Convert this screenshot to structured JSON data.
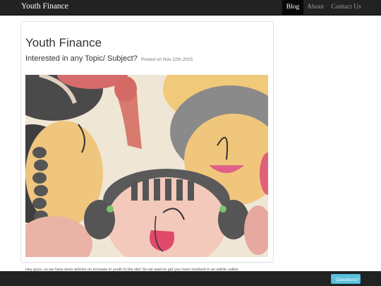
{
  "navbar": {
    "brand": "Youth Finance",
    "items": [
      {
        "label": "Blog"
      },
      {
        "label": "About"
      },
      {
        "label": "Contact Us"
      }
    ]
  },
  "post": {
    "title": "Youth Finance",
    "subtitle": "Interested in any Topic/ Subject?",
    "meta": "Posted on Nov 22th 2015",
    "snippet": "Hey guys, so we have been articles on increase in youth to the site! So we want to get you more involved in an article called"
  },
  "footer": {
    "questions_label": "Questions?"
  },
  "colors": {
    "navbar_bg": "#222222",
    "button_info": "#5bc0de"
  }
}
